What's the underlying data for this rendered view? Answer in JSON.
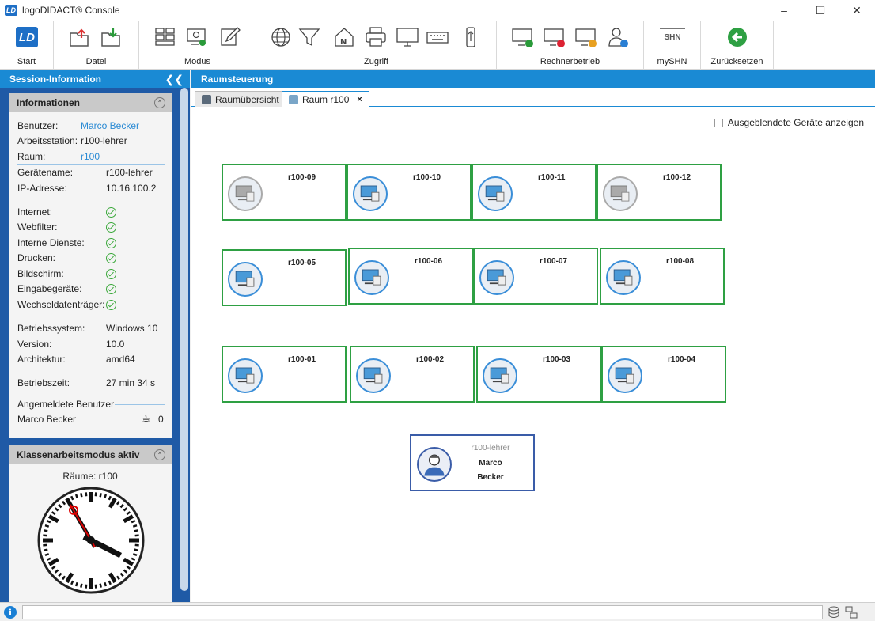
{
  "window": {
    "title": "logoDIDACT® Console",
    "logo": "LD"
  },
  "ribbon": {
    "start": "Start",
    "datei": "Datei",
    "modus": "Modus",
    "zugriff": "Zugriff",
    "rechnerbetrieb": "Rechnerbetrieb",
    "myshn": "mySHN",
    "myshn_icon_text": "SHN",
    "zuruecksetzen": "Zurücksetzen"
  },
  "left": {
    "header": "Session-Information",
    "info_title": "Informationen",
    "rows": {
      "benutzer_label": "Benutzer:",
      "benutzer_value": "Marco Becker",
      "arbeitsstation_label": "Arbeitsstation:",
      "arbeitsstation_value": "r100-lehrer",
      "raum_label": "Raum:",
      "raum_value": "r100",
      "geraetename_label": "Gerätename:",
      "geraetename_value": "r100-lehrer",
      "ip_label": "IP-Adresse:",
      "ip_value": "10.16.100.2",
      "internet": "Internet:",
      "webfilter": "Webfilter:",
      "interne_dienste": "Interne Dienste:",
      "drucken": "Drucken:",
      "bildschirm": "Bildschirm:",
      "eingabegeraete": "Eingabegeräte:",
      "wechseldatentraeger": "Wechseldatenträger:",
      "betriebssystem_label": "Betriebssystem:",
      "betriebssystem_value": "Windows 10",
      "version_label": "Version:",
      "version_value": "10.0",
      "architektur_label": "Architektur:",
      "architektur_value": "amd64",
      "betriebszeit_label": "Betriebszeit:",
      "betriebszeit_value": "27 min 34 s",
      "angemeldete_label": "Angemeldete Benutzer",
      "angemeldete_user": "Marco Becker",
      "angemeldete_count": "0"
    },
    "clock_title": "Klassenarbeitsmodus aktiv",
    "clock_rooms": "Räume: r100"
  },
  "main": {
    "header": "Raumsteuerung",
    "tabs": [
      {
        "label": "Raumübersicht"
      },
      {
        "label": "Raum r100",
        "close": "×"
      }
    ],
    "show_hidden": "Ausgeblendete Geräte anzeigen",
    "teacher": {
      "host": "r100-lehrer",
      "first": "Marco",
      "last": "Becker"
    },
    "pcs": {
      "r09": "r100-09",
      "r10": "r100-10",
      "r11": "r100-11",
      "r12": "r100-12",
      "r05": "r100-05",
      "r06": "r100-06",
      "r07": "r100-07",
      "r08": "r100-08",
      "r01": "r100-01",
      "r02": "r100-02",
      "r03": "r100-03",
      "r04": "r100-04"
    }
  },
  "status": {
    "info_icon": "i"
  }
}
